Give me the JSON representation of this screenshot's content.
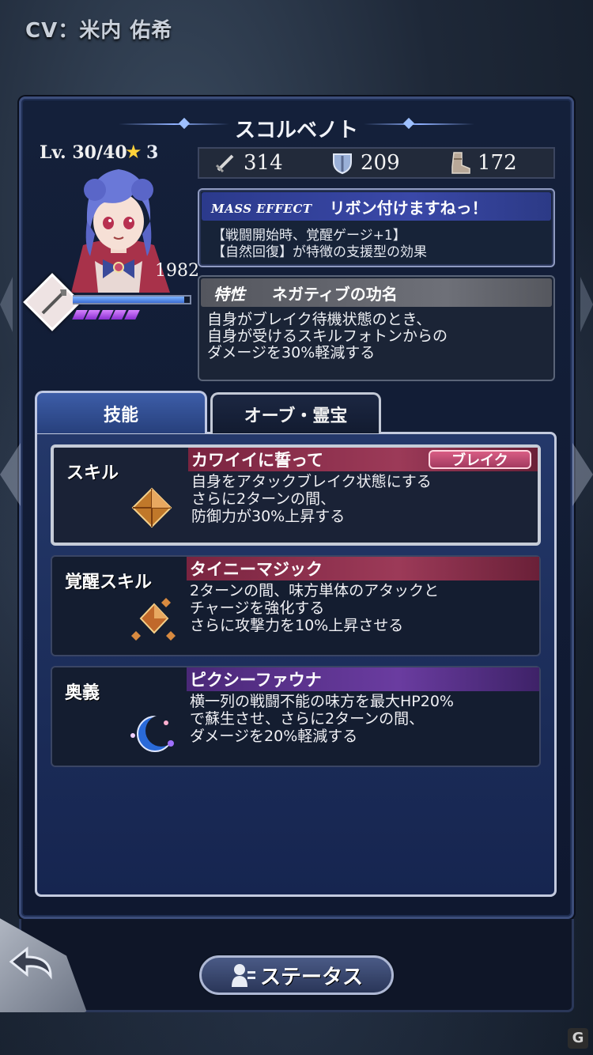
{
  "cv_label": "CV：米内 佑希",
  "character": {
    "name": "スコルベノト",
    "level": "Lv. 30/40",
    "rarity": "3",
    "power": "1982",
    "hp_fraction": 0.95,
    "gauge_segments": 5
  },
  "stats": {
    "attack": "314",
    "defense": "209",
    "speed": "172"
  },
  "mass_effect": {
    "label": "MASS EFFECT",
    "title": "リボン付けますねっ！",
    "desc_line1": "【戦闘開始時、覚醒ゲージ+1】",
    "desc_line2": "【自然回復】が特徴の支援型の効果"
  },
  "trait": {
    "label": "特性",
    "title": "ネガティブの功名",
    "desc_line1": "自身がブレイク待機状態のとき、",
    "desc_line2": "自身が受けるスキルフォトンからの",
    "desc_line3": "ダメージを30%軽減する"
  },
  "tabs": [
    {
      "label": "技能",
      "active": true
    },
    {
      "label": "オーブ・霊宝",
      "active": false
    }
  ],
  "skills": [
    {
      "type": "スキル",
      "name": "カワイイに誓って",
      "badge": "ブレイク",
      "desc_line1": "自身をアタックブレイク状態にする",
      "desc_line2": "さらに2ターンの間、",
      "desc_line3": "防御力が30%上昇する",
      "icon": "topaz-gem-icon"
    },
    {
      "type": "覚醒スキル",
      "name": "タイニーマジック",
      "desc_line1": "2ターンの間、味方単体のアタックと",
      "desc_line2": "チャージを強化する",
      "desc_line3": "さらに攻撃力を10%上昇させる",
      "icon": "multi-gem-icon"
    },
    {
      "type": "奥義",
      "name": "ピクシーファウナ",
      "desc_line1": "横一列の戦闘不能の味方を最大HP20%",
      "desc_line2": "で蘇生させ、さらに2ターンの間、",
      "desc_line3": "ダメージを20%軽減する",
      "icon": "moon-orb-icon"
    }
  ],
  "status_button": "ステータス",
  "colors": {
    "skill_bar": "#8a2e4e",
    "awaken_bar": "#8a2e4e",
    "ougi_bar": "#5a2c8c",
    "accent_blue": "#3a48a8"
  }
}
